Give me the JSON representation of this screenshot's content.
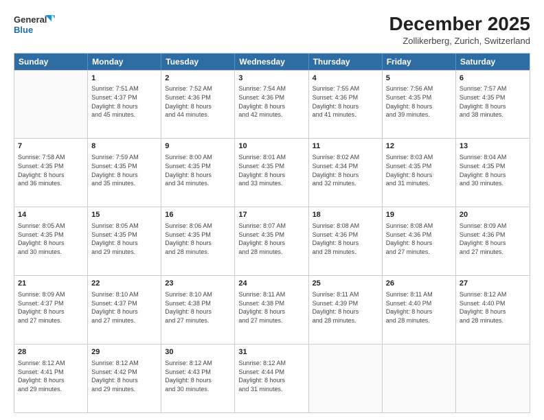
{
  "header": {
    "logo_line1": "General",
    "logo_line2": "Blue",
    "title": "December 2025",
    "subtitle": "Zollikerberg, Zurich, Switzerland"
  },
  "weekdays": [
    "Sunday",
    "Monday",
    "Tuesday",
    "Wednesday",
    "Thursday",
    "Friday",
    "Saturday"
  ],
  "rows": [
    [
      {
        "day": "",
        "info": ""
      },
      {
        "day": "1",
        "info": "Sunrise: 7:51 AM\nSunset: 4:37 PM\nDaylight: 8 hours\nand 45 minutes."
      },
      {
        "day": "2",
        "info": "Sunrise: 7:52 AM\nSunset: 4:36 PM\nDaylight: 8 hours\nand 44 minutes."
      },
      {
        "day": "3",
        "info": "Sunrise: 7:54 AM\nSunset: 4:36 PM\nDaylight: 8 hours\nand 42 minutes."
      },
      {
        "day": "4",
        "info": "Sunrise: 7:55 AM\nSunset: 4:36 PM\nDaylight: 8 hours\nand 41 minutes."
      },
      {
        "day": "5",
        "info": "Sunrise: 7:56 AM\nSunset: 4:35 PM\nDaylight: 8 hours\nand 39 minutes."
      },
      {
        "day": "6",
        "info": "Sunrise: 7:57 AM\nSunset: 4:35 PM\nDaylight: 8 hours\nand 38 minutes."
      }
    ],
    [
      {
        "day": "7",
        "info": "Sunrise: 7:58 AM\nSunset: 4:35 PM\nDaylight: 8 hours\nand 36 minutes."
      },
      {
        "day": "8",
        "info": "Sunrise: 7:59 AM\nSunset: 4:35 PM\nDaylight: 8 hours\nand 35 minutes."
      },
      {
        "day": "9",
        "info": "Sunrise: 8:00 AM\nSunset: 4:35 PM\nDaylight: 8 hours\nand 34 minutes."
      },
      {
        "day": "10",
        "info": "Sunrise: 8:01 AM\nSunset: 4:35 PM\nDaylight: 8 hours\nand 33 minutes."
      },
      {
        "day": "11",
        "info": "Sunrise: 8:02 AM\nSunset: 4:34 PM\nDaylight: 8 hours\nand 32 minutes."
      },
      {
        "day": "12",
        "info": "Sunrise: 8:03 AM\nSunset: 4:35 PM\nDaylight: 8 hours\nand 31 minutes."
      },
      {
        "day": "13",
        "info": "Sunrise: 8:04 AM\nSunset: 4:35 PM\nDaylight: 8 hours\nand 30 minutes."
      }
    ],
    [
      {
        "day": "14",
        "info": "Sunrise: 8:05 AM\nSunset: 4:35 PM\nDaylight: 8 hours\nand 30 minutes."
      },
      {
        "day": "15",
        "info": "Sunrise: 8:05 AM\nSunset: 4:35 PM\nDaylight: 8 hours\nand 29 minutes."
      },
      {
        "day": "16",
        "info": "Sunrise: 8:06 AM\nSunset: 4:35 PM\nDaylight: 8 hours\nand 28 minutes."
      },
      {
        "day": "17",
        "info": "Sunrise: 8:07 AM\nSunset: 4:35 PM\nDaylight: 8 hours\nand 28 minutes."
      },
      {
        "day": "18",
        "info": "Sunrise: 8:08 AM\nSunset: 4:36 PM\nDaylight: 8 hours\nand 28 minutes."
      },
      {
        "day": "19",
        "info": "Sunrise: 8:08 AM\nSunset: 4:36 PM\nDaylight: 8 hours\nand 27 minutes."
      },
      {
        "day": "20",
        "info": "Sunrise: 8:09 AM\nSunset: 4:36 PM\nDaylight: 8 hours\nand 27 minutes."
      }
    ],
    [
      {
        "day": "21",
        "info": "Sunrise: 8:09 AM\nSunset: 4:37 PM\nDaylight: 8 hours\nand 27 minutes."
      },
      {
        "day": "22",
        "info": "Sunrise: 8:10 AM\nSunset: 4:37 PM\nDaylight: 8 hours\nand 27 minutes."
      },
      {
        "day": "23",
        "info": "Sunrise: 8:10 AM\nSunset: 4:38 PM\nDaylight: 8 hours\nand 27 minutes."
      },
      {
        "day": "24",
        "info": "Sunrise: 8:11 AM\nSunset: 4:38 PM\nDaylight: 8 hours\nand 27 minutes."
      },
      {
        "day": "25",
        "info": "Sunrise: 8:11 AM\nSunset: 4:39 PM\nDaylight: 8 hours\nand 28 minutes."
      },
      {
        "day": "26",
        "info": "Sunrise: 8:11 AM\nSunset: 4:40 PM\nDaylight: 8 hours\nand 28 minutes."
      },
      {
        "day": "27",
        "info": "Sunrise: 8:12 AM\nSunset: 4:40 PM\nDaylight: 8 hours\nand 28 minutes."
      }
    ],
    [
      {
        "day": "28",
        "info": "Sunrise: 8:12 AM\nSunset: 4:41 PM\nDaylight: 8 hours\nand 29 minutes."
      },
      {
        "day": "29",
        "info": "Sunrise: 8:12 AM\nSunset: 4:42 PM\nDaylight: 8 hours\nand 29 minutes."
      },
      {
        "day": "30",
        "info": "Sunrise: 8:12 AM\nSunset: 4:43 PM\nDaylight: 8 hours\nand 30 minutes."
      },
      {
        "day": "31",
        "info": "Sunrise: 8:12 AM\nSunset: 4:44 PM\nDaylight: 8 hours\nand 31 minutes."
      },
      {
        "day": "",
        "info": ""
      },
      {
        "day": "",
        "info": ""
      },
      {
        "day": "",
        "info": ""
      }
    ]
  ]
}
